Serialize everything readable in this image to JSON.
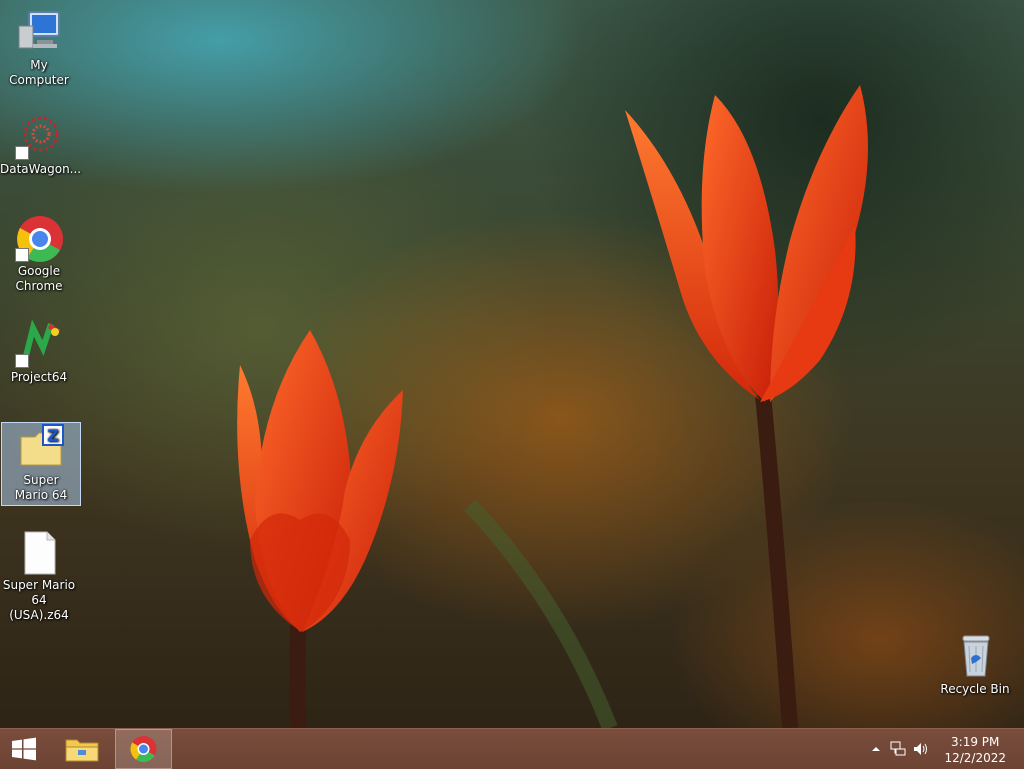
{
  "desktop": {
    "icons": [
      {
        "label": "My Computer"
      },
      {
        "label": "DataWagon..."
      },
      {
        "label": "Google Chrome"
      },
      {
        "label": "Project64"
      },
      {
        "label": "Super Mario 64"
      },
      {
        "label": "Super Mario 64 (USA).z64"
      },
      {
        "label": "Recycle Bin"
      }
    ]
  },
  "taskbar": {
    "start_icon": "windows-logo-icon",
    "pinned": [
      {
        "icon": "file-explorer-icon"
      },
      {
        "icon": "chrome-icon",
        "active": true
      }
    ],
    "tray": {
      "time": "3:19 PM",
      "date": "12/2/2022"
    }
  },
  "colors": {
    "taskbar": "#6f4536",
    "selection": "#aac8eb"
  }
}
